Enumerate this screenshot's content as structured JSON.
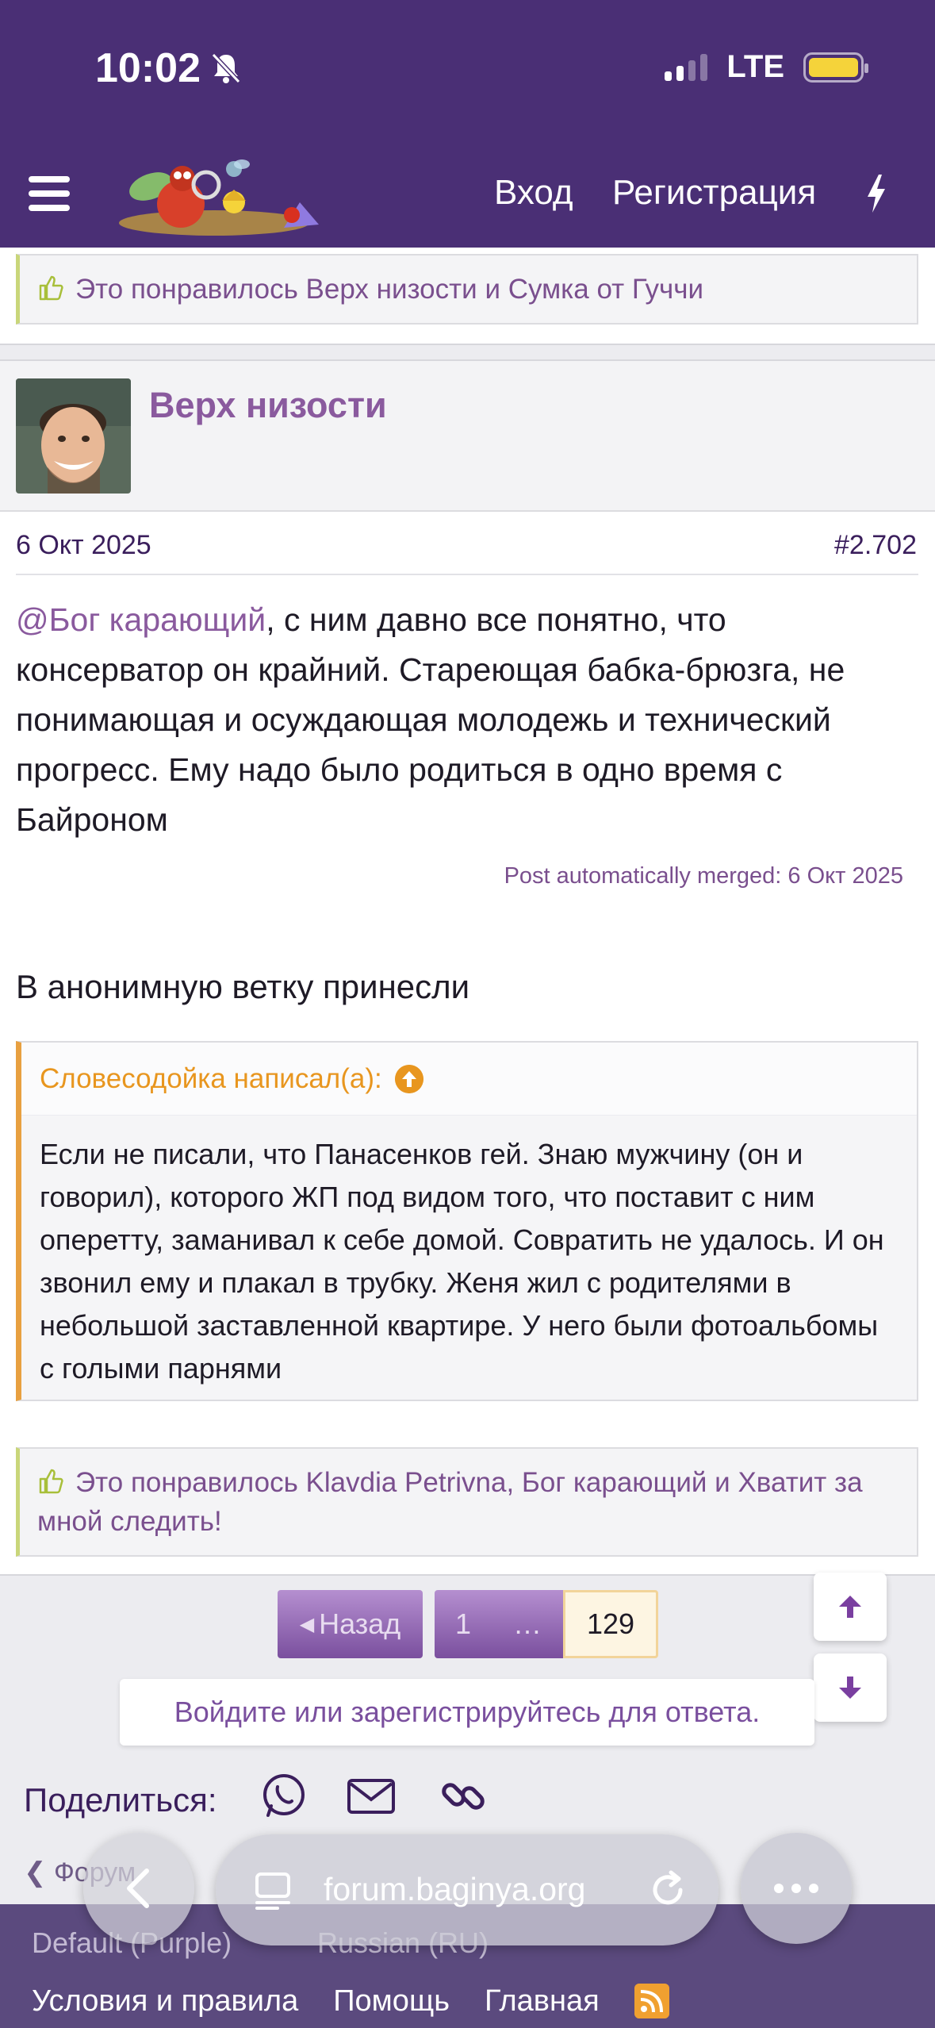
{
  "status": {
    "time": "10:02",
    "network": "LTE"
  },
  "header": {
    "login": "Вход",
    "register": "Регистрация"
  },
  "likes_top": {
    "text": "Это понравилось Верх низости и Сумка от Гуччи"
  },
  "post": {
    "author": "Верх низости",
    "date": "6 Окт 2025",
    "number": "#2.702",
    "mention": "@Бог карающий",
    "body_rest": ", с ним давно все понятно, что консерватор он крайний. Стареющая бабка-брюзга, не понимающая и осуждающая молодежь и технический прогресс. Ему надо было родиться в одно время с Байроном",
    "merged_note": "Post automatically merged: 6 Окт 2025",
    "body2": "В анонимную ветку принесли",
    "quote": {
      "author_line": "Словесодойка написал(а):",
      "text": "Если не писали, что Панасенков гей. Знаю мужчину (он и говорил), которого ЖП под видом того, что поставит с ним оперетту, заманивал к себе домой. Совратить не удалось. И он звонил ему и плакал в трубку. Женя жил с родителями в небольшой заставленной квартире. У него были фотоальбомы с голыми парнями"
    },
    "likes": "Это понравилось Klavdia Petrivna, Бог карающий и Хватит за мной следить!"
  },
  "pager": {
    "back": "Назад",
    "first": "1",
    "dots": "…",
    "current": "129"
  },
  "reply_prompt": "Войдите или зарегистрируйтесь для ответа.",
  "share": {
    "label": "Поделиться:"
  },
  "breadcrumb": "Форум",
  "footer": {
    "style": "Default (Purple)",
    "language": "Russian (RU)",
    "links": [
      "Условия и правила",
      "Помощь",
      "Главная"
    ]
  },
  "browser": {
    "url": "forum.baginya.org"
  },
  "colors": {
    "header_bg": "#4a2f75",
    "accent": "#8a5a9e",
    "quote_accent": "#e8961f"
  }
}
